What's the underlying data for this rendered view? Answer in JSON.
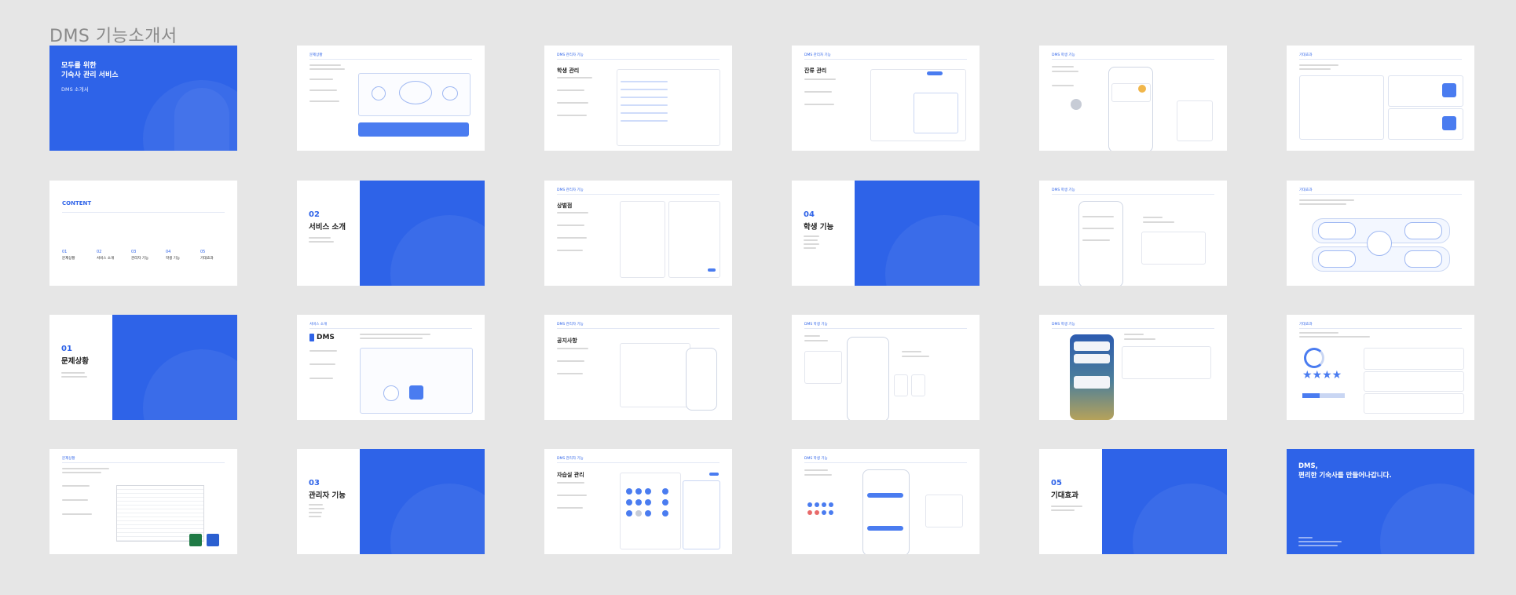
{
  "document": {
    "title": "DMS 기능소개서"
  },
  "cover": {
    "title_line1": "모두를 위한",
    "title_line2": "기숙사 관리 서비스",
    "subtitle": "DMS 소개서"
  },
  "contents": {
    "label": "CONTENT",
    "items": [
      {
        "num": "01",
        "title": "문제상황"
      },
      {
        "num": "02",
        "title": "서비스 소개"
      },
      {
        "num": "03",
        "title": "관리자 기능"
      },
      {
        "num": "04",
        "title": "학생 기능"
      },
      {
        "num": "05",
        "title": "기대효과"
      }
    ]
  },
  "sections": [
    {
      "num": "01",
      "title": "문제상황"
    },
    {
      "num": "02",
      "title": "서비스 소개"
    },
    {
      "num": "03",
      "title": "관리자 기능"
    },
    {
      "num": "04",
      "title": "학생 기능"
    },
    {
      "num": "05",
      "title": "기대효과"
    }
  ],
  "slides": {
    "problem_a": {
      "header": "문제상황"
    },
    "problem_b": {
      "header": "문제상황"
    },
    "service": {
      "header": "서비스 소개",
      "logo": "DMS"
    },
    "admin_student": {
      "header": "DMS 관리자 기능",
      "title": "학생 관리"
    },
    "admin_point": {
      "header": "DMS 관리자 기능",
      "title": "상벌점"
    },
    "admin_notice": {
      "header": "DMS 관리자 기능",
      "title": "공지사항"
    },
    "admin_study": {
      "header": "DMS 관리자 기능",
      "title": "자습실 관리"
    },
    "admin_stay": {
      "header": "DMS 관리자 기능",
      "title": "잔류 관리"
    },
    "stu_a": {
      "header": "DMS 학생 기능"
    },
    "stu_b": {
      "header": "DMS 학생 기능"
    },
    "stu_c": {
      "header": "DMS 학생 기능"
    },
    "stu_d": {
      "header": "DMS 학생 기능"
    },
    "stu_e": {
      "header": "DMS 학생 기능"
    },
    "stu_f": {
      "header": "DMS 학생 기능"
    },
    "stu_g": {
      "header": "DMS 학생 기능"
    },
    "effect_a": {
      "header": "기대효과"
    },
    "effect_b": {
      "header": "기대효과"
    },
    "effect_c": {
      "header": "기대효과"
    }
  },
  "ending": {
    "title_line1": "DMS,",
    "title_line2": "편리한 기숙사를 만들어나갑니다."
  }
}
